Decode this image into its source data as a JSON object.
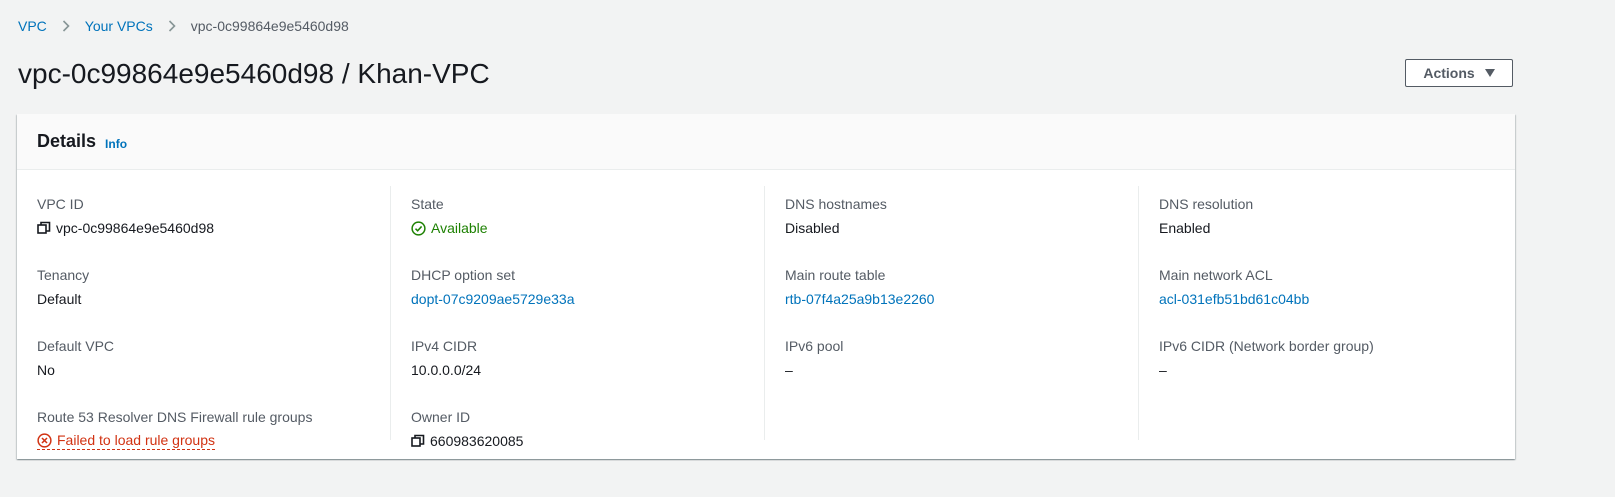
{
  "breadcrumb": {
    "items": [
      {
        "label": "VPC"
      },
      {
        "label": "Your VPCs"
      },
      {
        "label": "vpc-0c99864e9e5460d98"
      }
    ]
  },
  "page": {
    "title": "vpc-0c99864e9e5460d98 / Khan-VPC"
  },
  "actions": {
    "label": "Actions"
  },
  "details": {
    "title": "Details",
    "info_label": "Info",
    "columns": [
      [
        {
          "label": "VPC ID",
          "value": "vpc-0c99864e9e5460d98",
          "icon": "copy-icon"
        },
        {
          "label": "Tenancy",
          "value": "Default"
        },
        {
          "label": "Default VPC",
          "value": "No"
        },
        {
          "label": "Route 53 Resolver DNS Firewall rule groups",
          "value": "Failed to load rule groups",
          "icon": "error-circle-icon"
        }
      ],
      [
        {
          "label": "State",
          "value": "Available",
          "icon": "check-circle-icon"
        },
        {
          "label": "DHCP option set",
          "value": "dopt-07c9209ae5729e33a"
        },
        {
          "label": "IPv4 CIDR",
          "value": "10.0.0.0/24"
        },
        {
          "label": "Owner ID",
          "value": "660983620085",
          "icon": "copy-icon"
        }
      ],
      [
        {
          "label": "DNS hostnames",
          "value": "Disabled"
        },
        {
          "label": "Main route table",
          "value": "rtb-07f4a25a9b13e2260"
        },
        {
          "label": "IPv6 pool",
          "value": "–"
        }
      ],
      [
        {
          "label": "DNS resolution",
          "value": "Enabled"
        },
        {
          "label": "Main network ACL",
          "value": "acl-031efb51bd61c04bb"
        },
        {
          "label": "IPv6 CIDR (Network border group)",
          "value": "–"
        }
      ]
    ]
  },
  "colors": {
    "link": "#0073bb",
    "success": "#1d8102",
    "error": "#d13212",
    "label": "#545b64",
    "text": "#16191f",
    "background": "#f2f3f3"
  }
}
